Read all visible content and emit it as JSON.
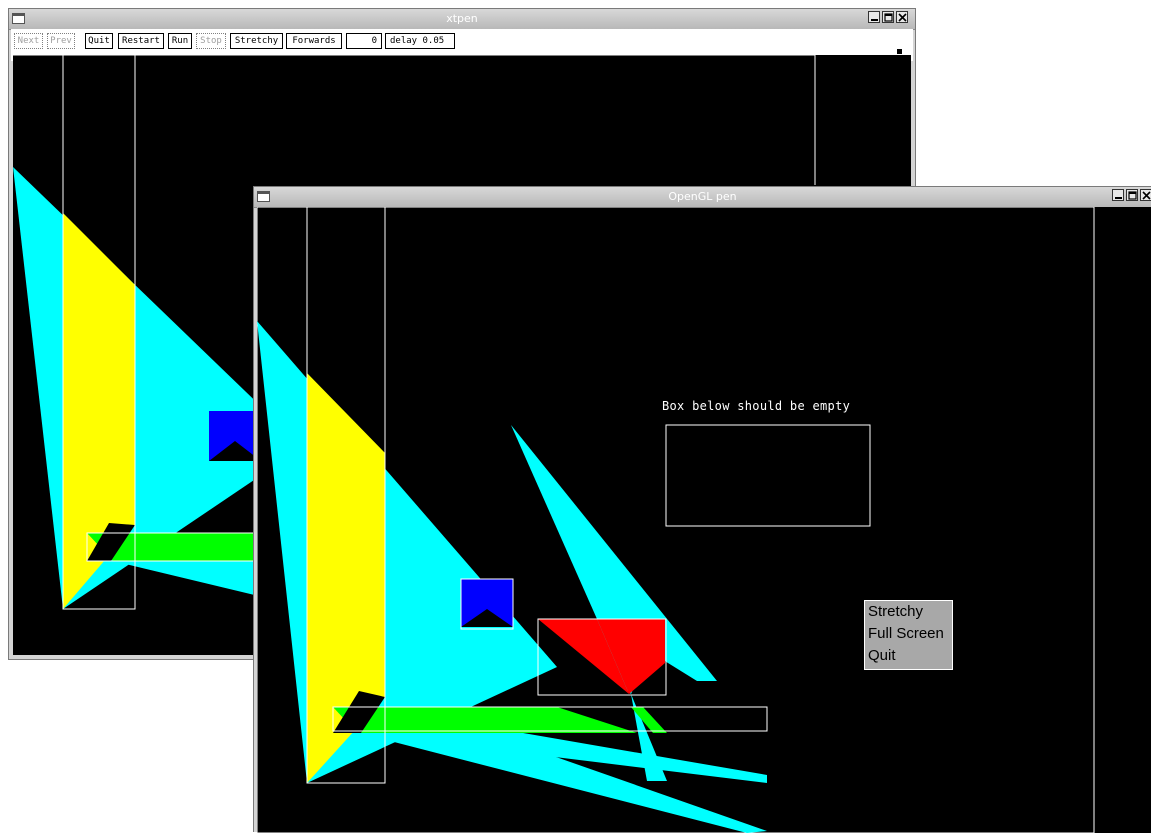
{
  "xtpen": {
    "title": "xtpen",
    "toolbar": {
      "next": "Next",
      "prev": "Prev",
      "quit": "Quit",
      "restart": "Restart",
      "run": "Run",
      "stop": "Stop",
      "stretchy": "Stretchy",
      "forwards": "Forwards",
      "frame": "0",
      "delay": "delay 0.05"
    }
  },
  "opengl": {
    "title": "OpenGL pen",
    "label": "Box below should be empty",
    "menu": {
      "stretchy": "Stretchy",
      "full_screen": "Full Screen",
      "quit": "Quit"
    }
  },
  "colors": {
    "cyan": "#00ffff",
    "yellow": "#ffff00",
    "blue": "#0000ff",
    "green": "#00ff00",
    "red": "#ff0000",
    "background": "#000000"
  },
  "icons": [
    "window-menu-icon",
    "minimize-icon",
    "maximize-icon",
    "close-icon"
  ]
}
